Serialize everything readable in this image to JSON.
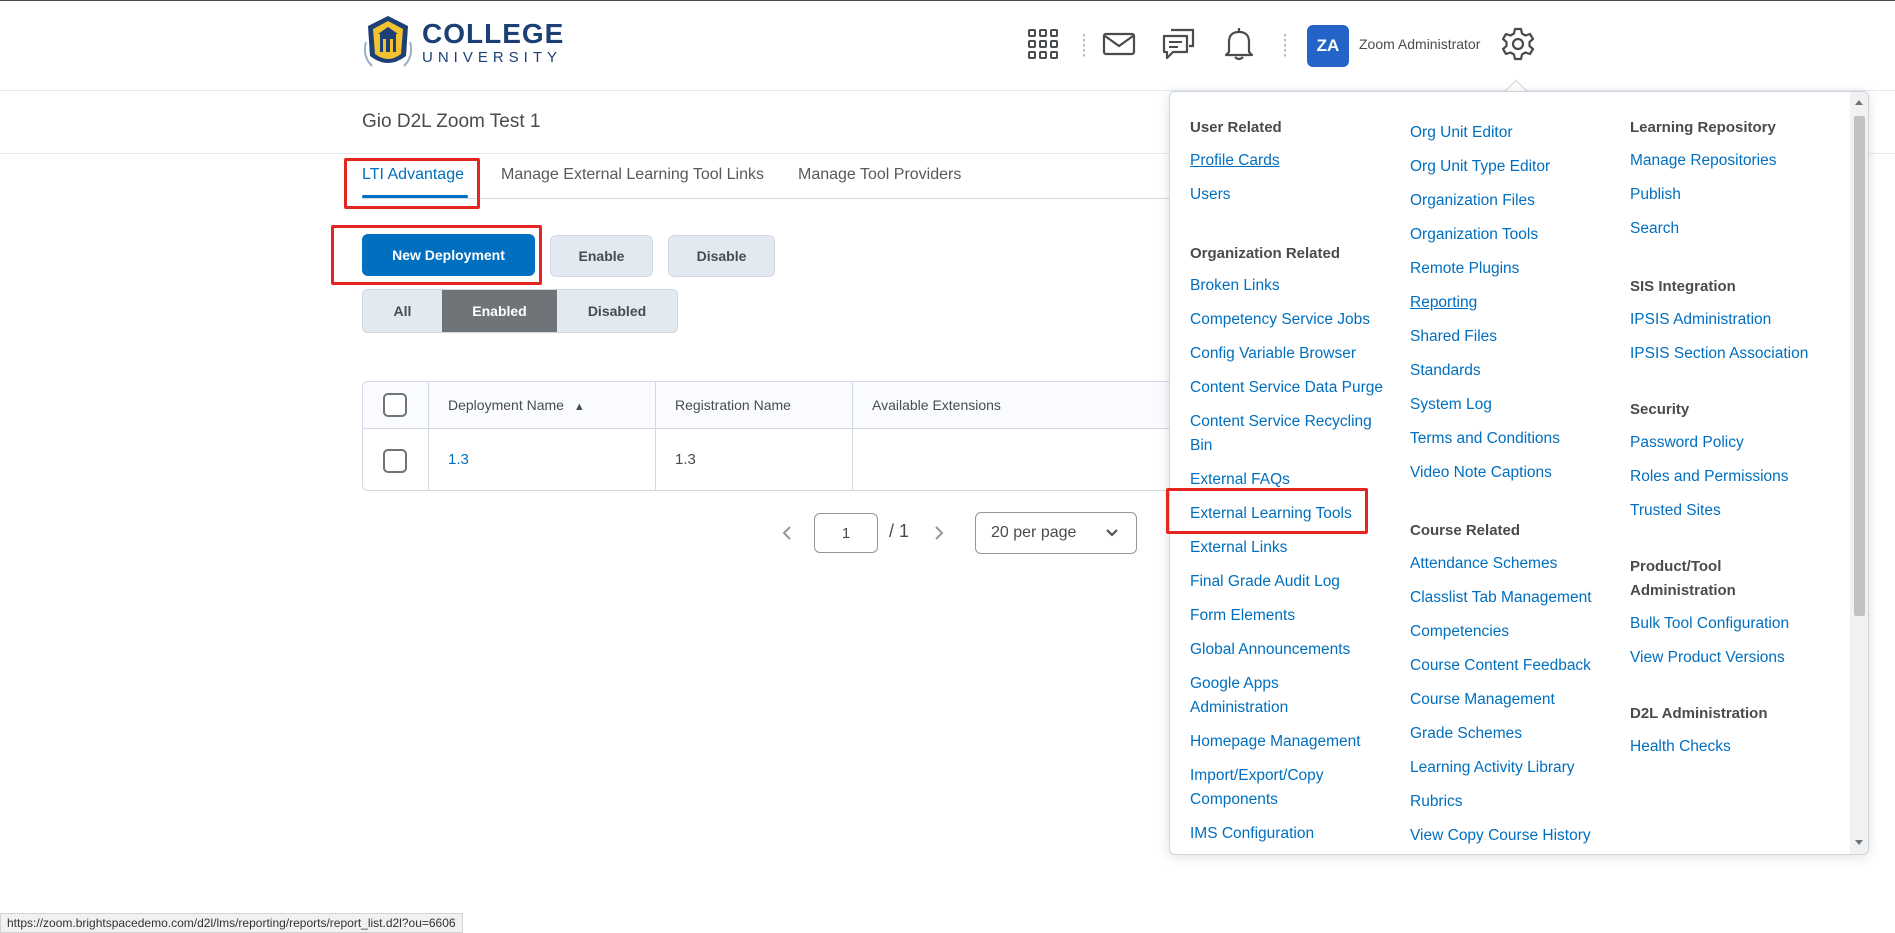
{
  "header": {
    "logo_line1": "COLLEGE",
    "logo_line2": "UNIVERSITY",
    "avatar_initials": "ZA",
    "user_name": "Zoom Administrator",
    "icons": [
      "waffle-icon",
      "mail-icon",
      "chat-icon",
      "bell-icon",
      "gear-icon"
    ]
  },
  "page": {
    "title": "Gio D2L Zoom Test 1"
  },
  "tabs": [
    {
      "label": "LTI Advantage",
      "active": true
    },
    {
      "label": "Manage External Learning Tool Links",
      "active": false
    },
    {
      "label": "Manage Tool Providers",
      "active": false
    }
  ],
  "buttons": {
    "new_deployment": "New Deployment",
    "enable": "Enable",
    "disable": "Disable"
  },
  "filter": {
    "all": "All",
    "enabled": "Enabled",
    "disabled": "Disabled",
    "selected": "Enabled"
  },
  "table": {
    "headers": [
      "Deployment Name",
      "Registration Name",
      "Available Extensions"
    ],
    "sort_indicator": "▲",
    "rows": [
      {
        "deployment": "1.3",
        "registration": "1.3",
        "extensions": ""
      }
    ]
  },
  "pager": {
    "current": "1",
    "total": "/ 1",
    "per_page": "20 per page"
  },
  "menu": {
    "col1": {
      "user_related": "User Related",
      "profile_cards": "Profile Cards",
      "users": "Users",
      "org_related": "Organization Related",
      "items": [
        "Broken Links",
        "Competency Service Jobs",
        "Config Variable Browser",
        "Content Service Data Purge",
        "Content Service Recycling Bin",
        "External FAQs",
        "External Learning Tools",
        "External Links",
        "Final Grade Audit Log",
        "Form Elements",
        "Global Announcements",
        "Google Apps Administration",
        "Homepage Management",
        "Import/Export/Copy Components",
        "IMS Configuration"
      ]
    },
    "col2": {
      "items": [
        "Org Unit Editor",
        "Org Unit Type Editor",
        "Organization Files",
        "Organization Tools",
        "Remote Plugins",
        "Reporting",
        "Shared Files",
        "Standards",
        "System Log",
        "Terms and Conditions",
        "Video Note Captions"
      ],
      "course_related": "Course Related",
      "course_items": [
        "Attendance Schemes",
        "Classlist Tab Management",
        "Competencies",
        "Course Content Feedback",
        "Course Management",
        "Grade Schemes",
        "Learning Activity Library",
        "Rubrics",
        "View Copy Course History"
      ]
    },
    "col3": {
      "learning_repository": "Learning Repository",
      "lr_items": [
        "Manage Repositories",
        "Publish",
        "Search"
      ],
      "sis_integration": "SIS Integration",
      "sis_items": [
        "IPSIS Administration",
        "IPSIS Section Association"
      ],
      "security": "Security",
      "security_items": [
        "Password Policy",
        "Roles and Permissions",
        "Trusted Sites"
      ],
      "product_tool_admin": "Product/Tool Administration",
      "pt_items": [
        "Bulk Tool Configuration",
        "View Product Versions"
      ],
      "d2l_admin": "D2L Administration",
      "d2l_items": [
        "Health Checks"
      ]
    }
  },
  "status_url": "https://zoom.brightspacedemo.com/d2l/lms/reporting/reports/report_list.d2l?ou=6606",
  "colors": {
    "accent": "#006fbf",
    "highlight": "#e52520",
    "avatar": "#2464c8"
  }
}
